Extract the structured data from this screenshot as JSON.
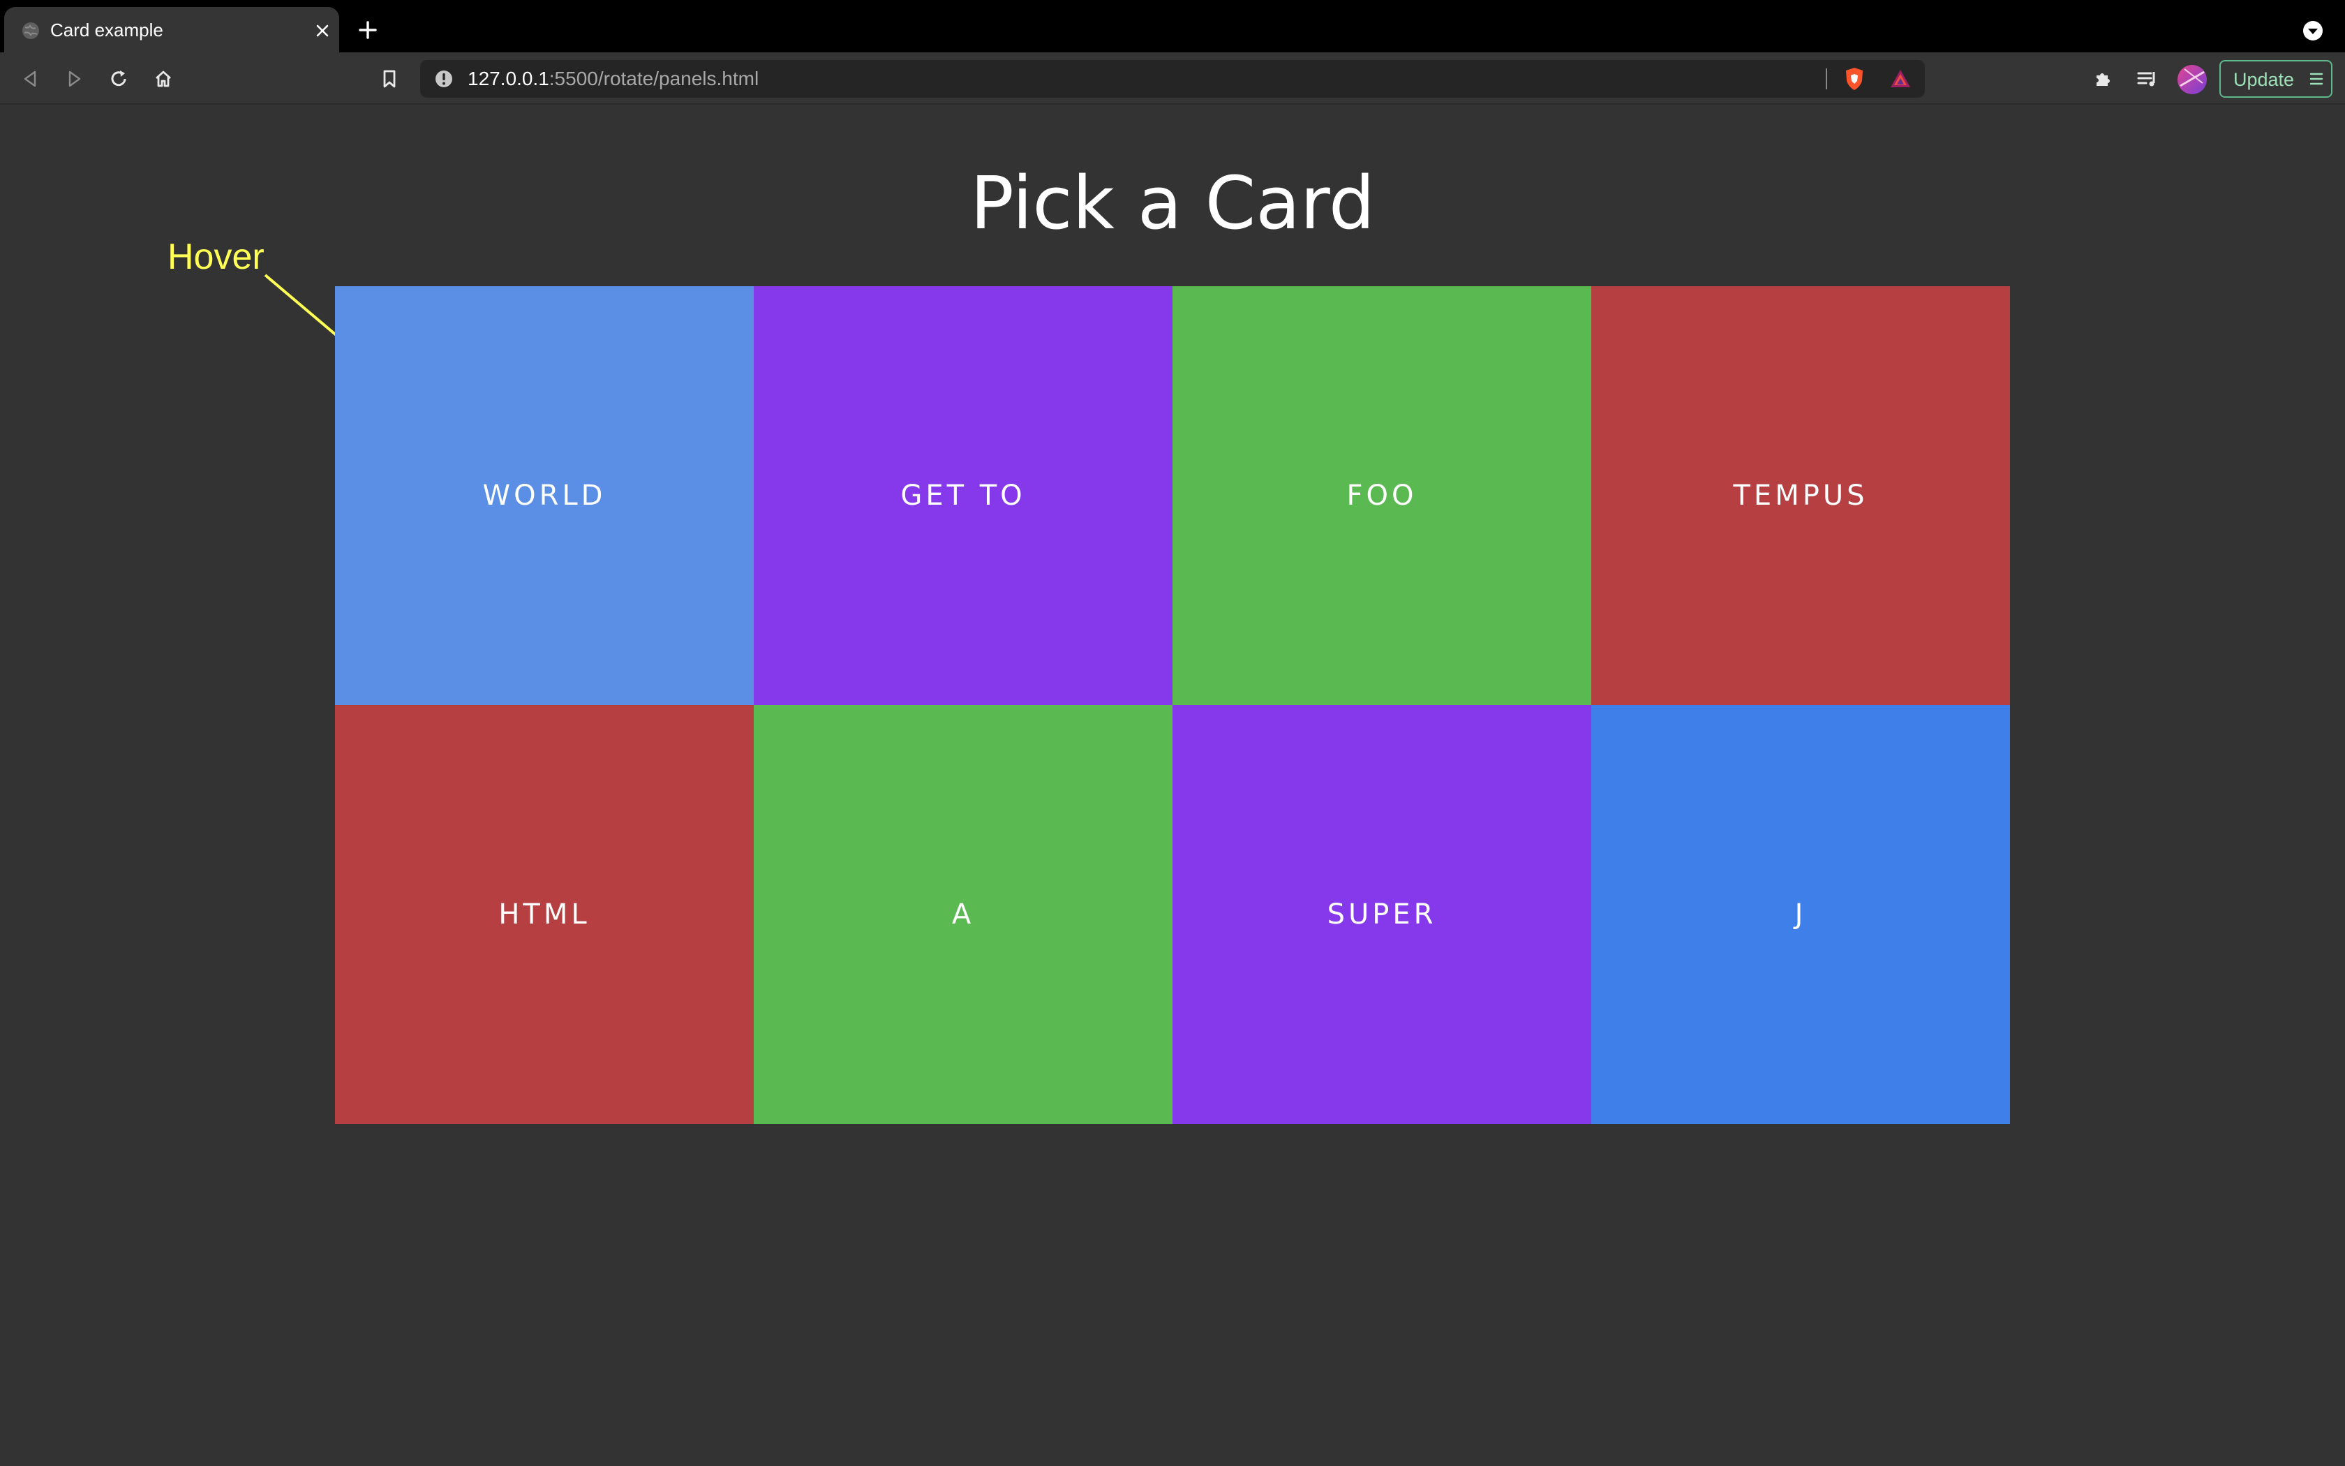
{
  "browser": {
    "tab": {
      "title": "Card example"
    },
    "address_bar": {
      "url_host": "127.0.0.1",
      "url_path": ":5500/rotate/panels.html"
    },
    "update_button": {
      "label": "Update"
    }
  },
  "page": {
    "title": "Pick a Card",
    "annotation": {
      "text": "Hover",
      "color": "#ffff55"
    },
    "cards": [
      {
        "label": "WORLD",
        "color": "#5b8ee5"
      },
      {
        "label": "GET TO",
        "color": "#8638eb"
      },
      {
        "label": "FOO",
        "color": "#5aba51"
      },
      {
        "label": "TEMPUS",
        "color": "#b63f42"
      },
      {
        "label": "HTML",
        "color": "#b63f42"
      },
      {
        "label": "A",
        "color": "#5aba51"
      },
      {
        "label": "SUPER",
        "color": "#8638eb"
      },
      {
        "label": "J",
        "color": "#3e7fea"
      }
    ]
  },
  "colors": {
    "page_background": "#333333",
    "tabstrip": "#000000",
    "toolbar": "#353535"
  }
}
